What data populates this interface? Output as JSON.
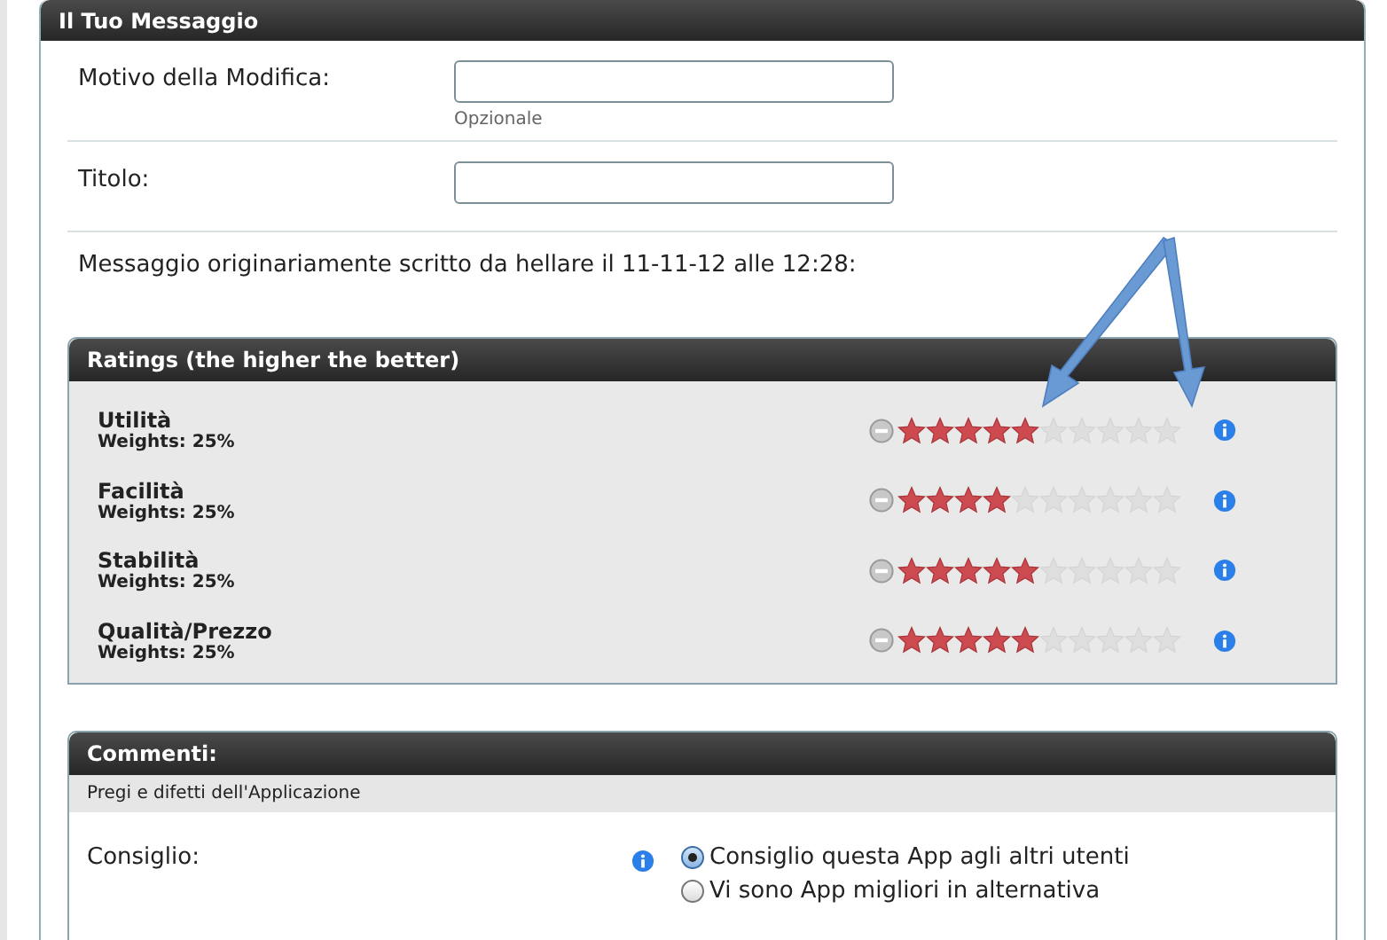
{
  "panel": {
    "title": "Il Tuo Messaggio"
  },
  "fields": [
    {
      "label": "Motivo della Modifica:",
      "hint": "Opzionale"
    },
    {
      "label": "Titolo:"
    }
  ],
  "original_note": "Messaggio originariamente scritto da hellare il 11-11-12 alle 12:28:",
  "ratings": {
    "title": "Ratings (the higher the better)",
    "items": [
      {
        "label": "Utilità",
        "weight": "Weights: 25%",
        "stars": 5
      },
      {
        "label": "Facilità",
        "weight": "Weights: 25%",
        "stars": 4
      },
      {
        "label": "Stabilità",
        "weight": "Weights: 25%",
        "stars": 5
      },
      {
        "label": "Qualità/Prezzo",
        "weight": "Weights: 25%",
        "stars": 5
      }
    ]
  },
  "comments": {
    "title": "Commenti:",
    "subtitle": "Pregi e difetti dell'Applicazione",
    "label": "Consiglio:",
    "options": [
      {
        "label": "Consiglio questa App agli altri utenti",
        "selected": true
      },
      {
        "label": "Vi sono App migliori in alternativa",
        "selected": false
      }
    ]
  }
}
